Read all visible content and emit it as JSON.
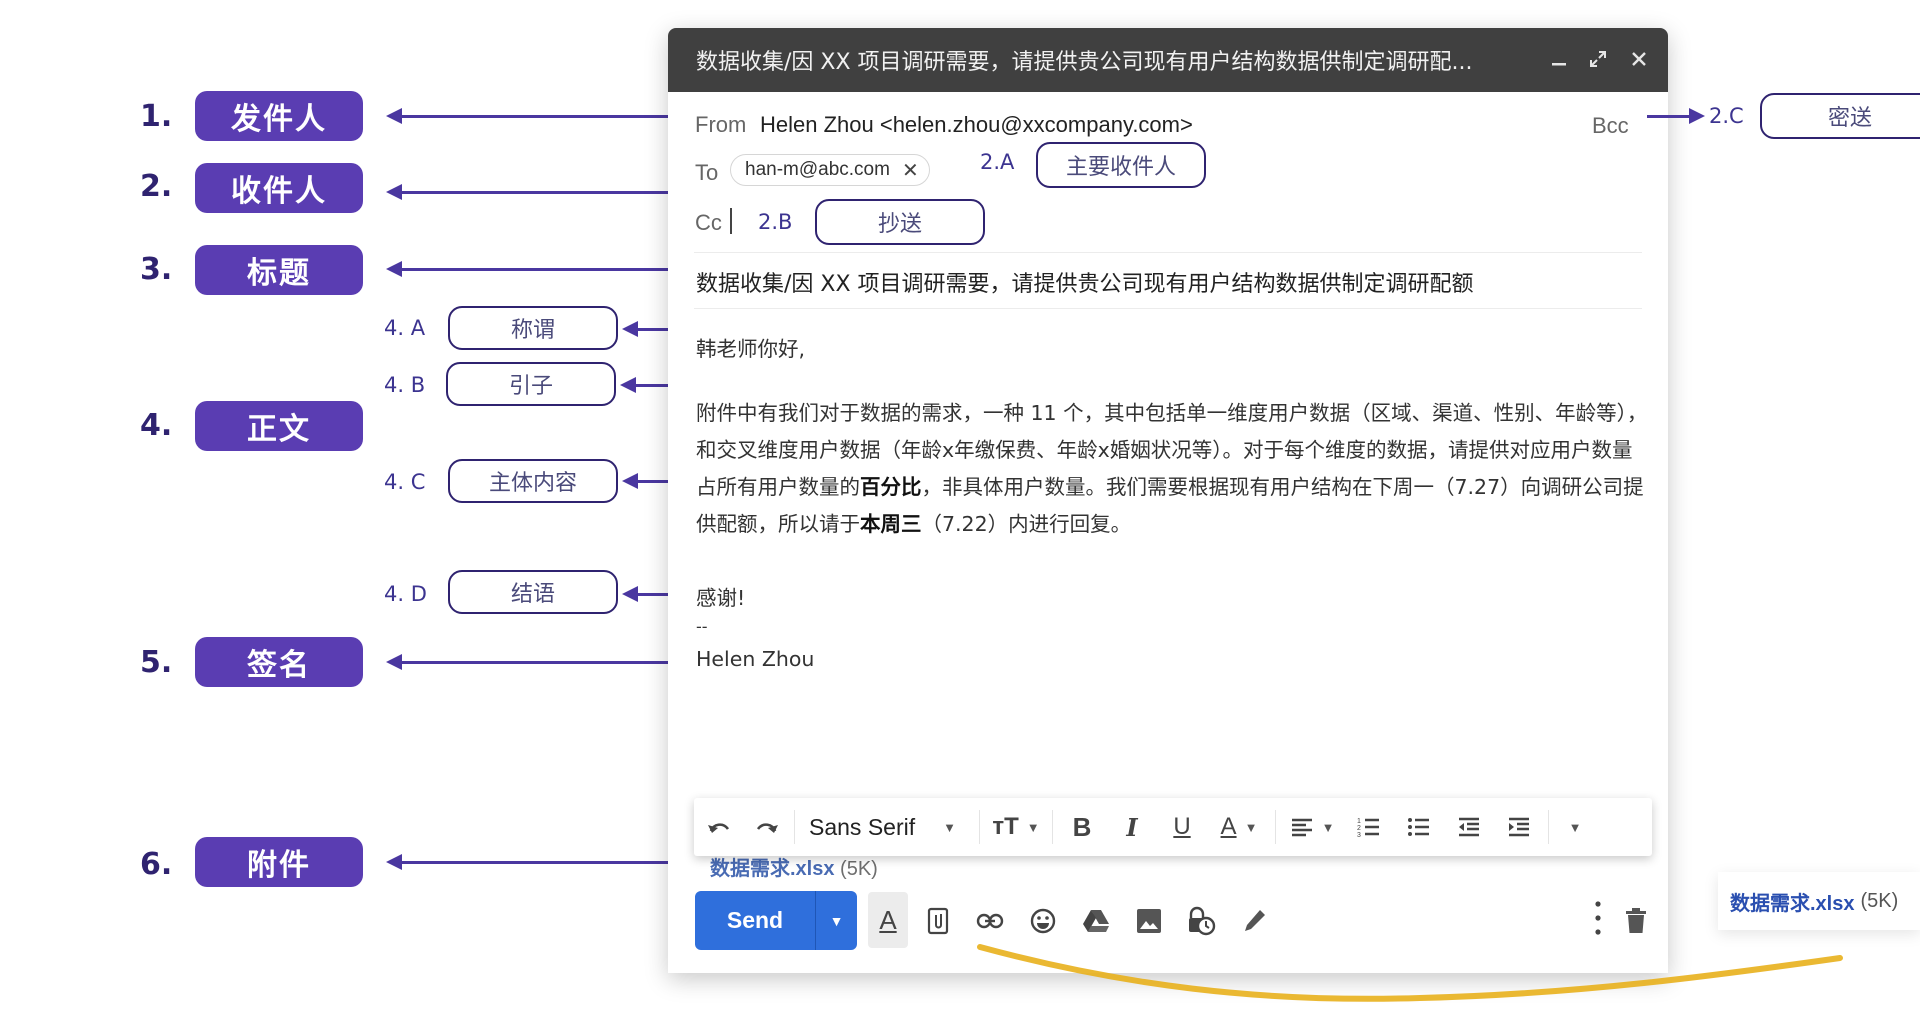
{
  "annotations": {
    "main": [
      {
        "num": "1.",
        "label": "发件人"
      },
      {
        "num": "2.",
        "label": "收件人"
      },
      {
        "num": "3.",
        "label": "标题"
      },
      {
        "num": "4.",
        "label": "正文"
      },
      {
        "num": "5.",
        "label": "签名"
      },
      {
        "num": "6.",
        "label": "附件"
      }
    ],
    "body_parts": [
      {
        "num": "4. A",
        "label": "称谓"
      },
      {
        "num": "4. B",
        "label": "引子"
      },
      {
        "num": "4. C",
        "label": "主体内容"
      },
      {
        "num": "4. D",
        "label": "结语"
      }
    ],
    "recipients": [
      {
        "num": "2.A",
        "label": "主要收件人"
      },
      {
        "num": "2.B",
        "label": "抄送"
      },
      {
        "num": "2.C",
        "label": "密送"
      }
    ]
  },
  "compose": {
    "title": "数据收集/因 XX 项目调研需要，请提供贵公司现有用户结构数据供制定调研配...",
    "window_controls": {
      "minimize": "minimize-icon",
      "expand": "expand-icon",
      "close": "close-icon"
    },
    "from_label": "From",
    "from_value": "Helen Zhou <helen.zhou@xxcompany.com>",
    "bcc_label": "Bcc",
    "to_label": "To",
    "to_chip": "han-m@abc.com",
    "cc_label": "Cc",
    "subject": "数据收集/因 XX 项目调研需要，请提供贵公司现有用户结构数据供制定调研配额",
    "body": {
      "greeting": "韩老师你好,",
      "paragraph_parts": [
        "附件中有我们对于数据的需求，一种 11 个，其中包括单一维度用户数据（区域、渠道、性别、年龄等），和交叉维度用户数据（年龄x年缴保费、年龄x婚姻状况等）。对于每个维度的数据，请提供对应用户数量占所有用户数量的",
        "百分比",
        "，非具体用户数量。我们需要根据现有用户结构在下周一（7.27）向调研公司提供配额，所以请于",
        "本周三",
        "（7.22）内进行回复。"
      ],
      "closing": "感谢!",
      "sig_separator": "--",
      "signature": "Helen Zhou"
    },
    "toolbar": {
      "font": "Sans Serif",
      "icons": [
        "undo-icon",
        "redo-icon",
        "font-size-icon",
        "bold-icon",
        "italic-icon",
        "underline-icon",
        "text-color-icon",
        "align-icon",
        "numbered-list-icon",
        "bulleted-list-icon",
        "indent-less-icon",
        "indent-more-icon",
        "more-formatting-icon"
      ]
    },
    "attachment": {
      "name": "数据需求.xlsx",
      "size": "(5K)"
    },
    "send_label": "Send"
  },
  "external_attachment": {
    "name": "数据需求.xlsx",
    "size": "(5K)"
  },
  "colors": {
    "annotation_purple": "#5a3db2",
    "annotation_dark": "#2f2370",
    "send_blue": "#2f6fdc",
    "titlebar": "#404040",
    "highlight_curve": "#e8b01c"
  }
}
